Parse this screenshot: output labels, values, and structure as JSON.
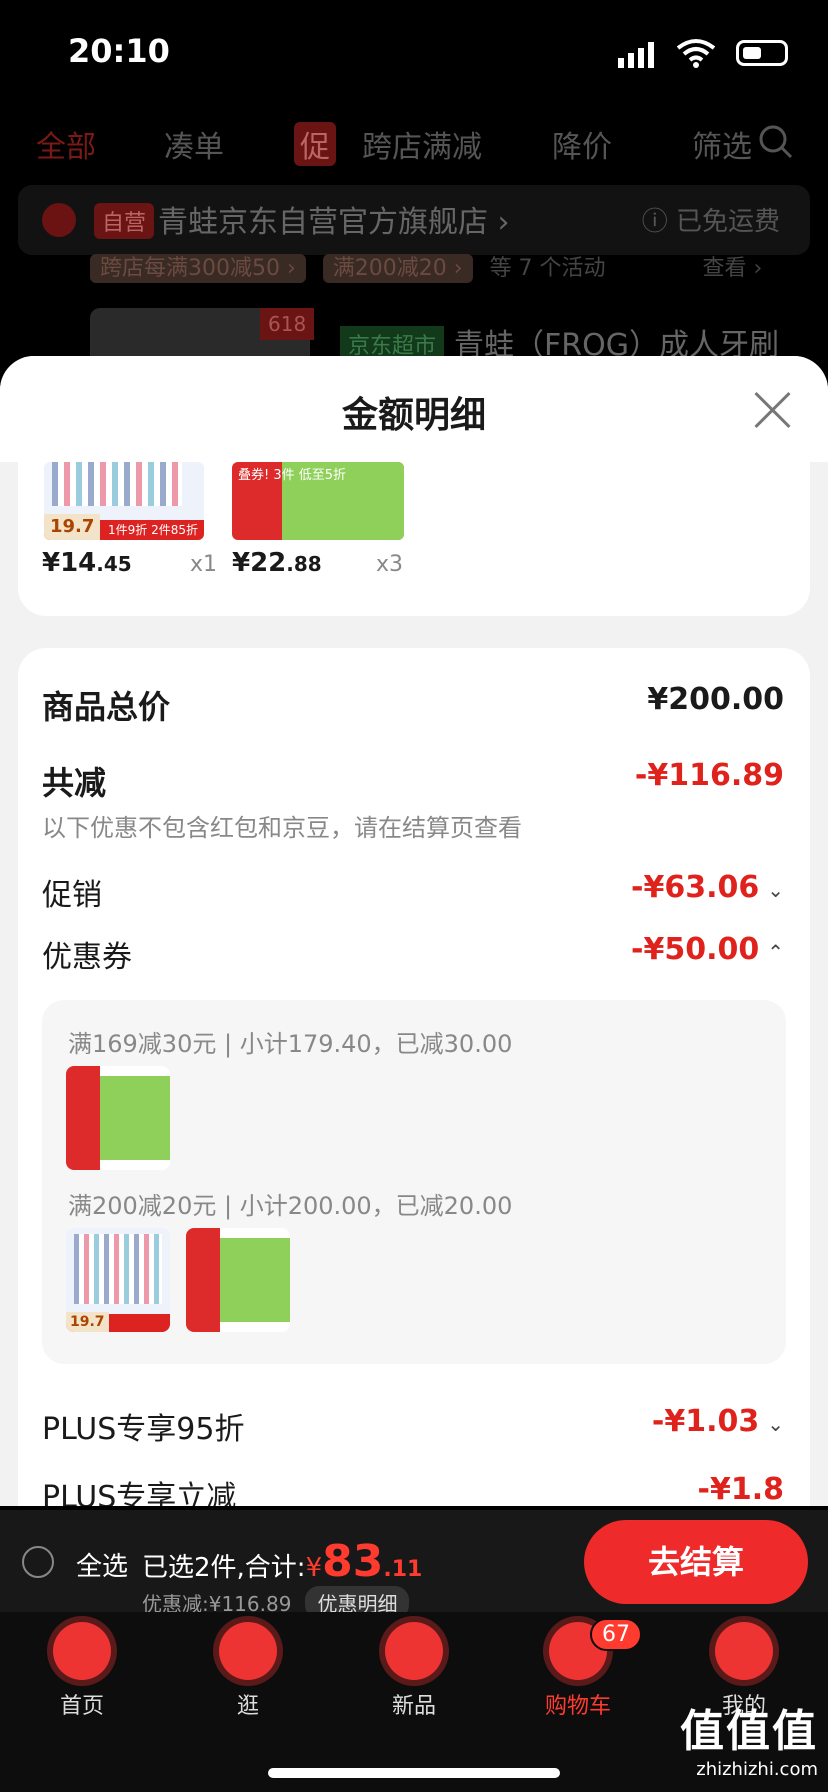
{
  "status": {
    "time": "20:10"
  },
  "background_page": {
    "tabs": [
      "全部",
      "凑单",
      "促",
      "跨店满减",
      "降价",
      "筛选"
    ],
    "store_tag": "自营",
    "store_name": "青蛙京东自营官方旗舰店 ›",
    "shipping": "ⓘ 已免运费",
    "promos": [
      "跨店每满300减50 ›",
      "满200减20 ›"
    ],
    "promo_tail": "等 7 个活动",
    "promo_link": "查看 ›",
    "badge_618": "618",
    "supermarket_tag": "京东超市",
    "product_name": "青蛙（FROG）成人牙刷"
  },
  "sheet": {
    "title": "金额明细",
    "items": [
      {
        "price_main": "¥14",
        "price_dec": ".45",
        "qty": "x1",
        "img_price": "19.7",
        "img_band": "1件9折 2件85折"
      },
      {
        "price_main": "¥22",
        "price_dec": ".88",
        "qty": "x3",
        "img_text": "叠券! 3件 低至5折"
      }
    ],
    "total_label": "商品总价",
    "total_value": "¥200.00",
    "reduce_label": "共减",
    "reduce_value": "-¥116.89",
    "reduce_note": "以下优惠不包含红包和京豆，请在结算页查看",
    "promo_label": "促销",
    "promo_value": "-¥63.06",
    "coupon_label": "优惠券",
    "coupon_value": "-¥50.00",
    "coupon_groups": [
      {
        "desc": "满169减30元 | 小计179.40，已减30.00"
      },
      {
        "desc": "满200减20元 | 小计200.00，已减20.00"
      }
    ],
    "plus_discount_label": "PLUS专享95折",
    "plus_discount_value": "-¥1.03",
    "plus_instant_label": "PLUS专享立减",
    "plus_instant_value": "-¥1.8"
  },
  "checkout": {
    "select_all": "全选",
    "selected_text": "已选2件,合计:",
    "currency": "¥",
    "amount_int": "83",
    "amount_dec": ".11",
    "discount_text": "优惠减:¥116.89",
    "discount_detail": "优惠明细",
    "pay_button": "去结算"
  },
  "tabbar": {
    "items": [
      "首页",
      "逛",
      "新品",
      "购物车",
      "我的"
    ],
    "cart_badge": "67",
    "active": "购物车"
  },
  "watermark": {
    "main": "值值值",
    "sub": "zhizhizhi.com"
  }
}
